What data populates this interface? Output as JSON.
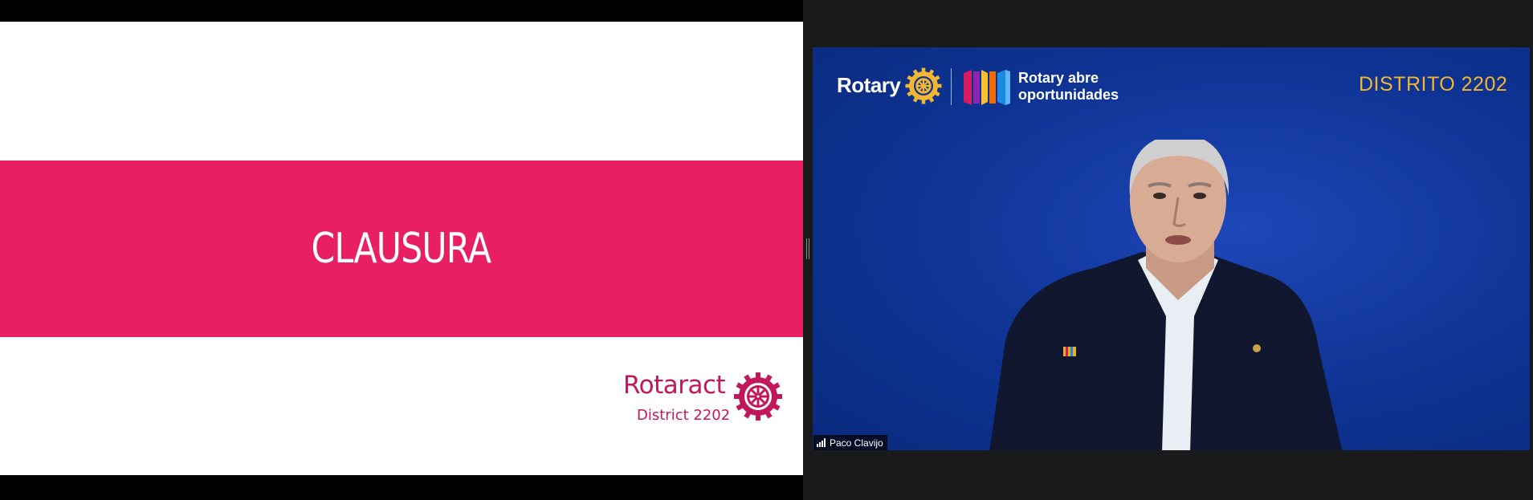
{
  "slide": {
    "title": "CLAUSURA",
    "logo_word": "Rotaract",
    "logo_district": "District 2202",
    "band_color": "#e91f63",
    "logo_color": "#c2185b"
  },
  "video": {
    "brand": "Rotary",
    "tagline_line1": "Rotary abre",
    "tagline_line2": "oportunidades",
    "district": "DISTRITO 2202",
    "participant_name": "Paco Clavijo",
    "background_color": "#0e3393",
    "accent_color": "#f2b630"
  },
  "icons": {
    "rotaract_wheel": "rotaract-wheel-icon",
    "rotary_wheel": "rotary-wheel-icon",
    "signal": "signal-strength-icon",
    "splitter": "splitter-handle-icon"
  }
}
